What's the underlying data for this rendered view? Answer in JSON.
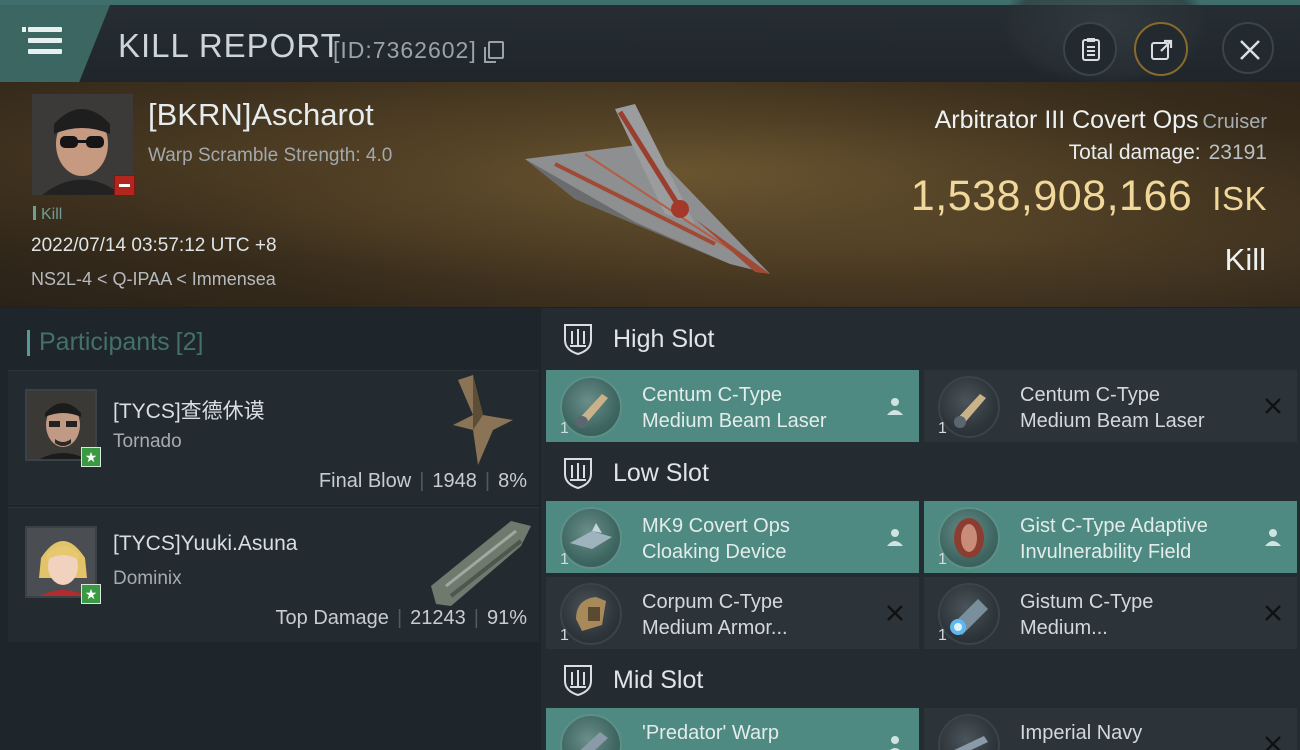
{
  "header": {
    "title": "KILL REPORT",
    "kill_id": "[ID:7362602]"
  },
  "victim": {
    "name": "[BKRN]Ascharot",
    "warp_scramble": "Warp Scramble Strength: 4.0",
    "tag": "Kill",
    "datetime": "2022/07/14 03:57:12 UTC +8",
    "location": "NS2L-4 < Q-IPAA < Immensea",
    "ship_name": "Arbitrator III Covert Ops",
    "ship_class": "Cruiser",
    "total_damage_label": "Total damage:",
    "total_damage_value": "23191",
    "isk_value": "1,538,908,166",
    "isk_unit": "ISK",
    "result": "Kill"
  },
  "participants": {
    "label": "Participants",
    "count": "[2]",
    "items": [
      {
        "name": "[TYCS]查德休谟",
        "ship": "Tornado",
        "role": "Final Blow",
        "damage": "1948",
        "percent": "8%"
      },
      {
        "name": "[TYCS]Yuuki.Asuna",
        "ship": "Dominix",
        "role": "Top Damage",
        "damage": "21243",
        "percent": "91%"
      }
    ]
  },
  "slots": {
    "high": {
      "title": "High Slot",
      "modules": [
        {
          "name": "Centum C-Type\nMedium Beam Laser",
          "qty": "1",
          "state": "dropped"
        },
        {
          "name": "Centum C-Type\nMedium Beam Laser",
          "qty": "1",
          "state": "destroyed"
        }
      ]
    },
    "low": {
      "title": "Low Slot",
      "modules": [
        {
          "name": "MK9 Covert Ops\nCloaking Device",
          "qty": "1",
          "state": "dropped"
        },
        {
          "name": "Gist C-Type Adaptive\nInvulnerability Field",
          "qty": "1",
          "state": "dropped"
        },
        {
          "name": "Corpum C-Type\nMedium Armor...",
          "qty": "1",
          "state": "destroyed"
        },
        {
          "name": "Gistum C-Type\nMedium...",
          "qty": "1",
          "state": "destroyed"
        }
      ]
    },
    "mid": {
      "title": "Mid Slot",
      "modules": [
        {
          "name": "'Predator' Warp",
          "qty": "1",
          "state": "dropped"
        },
        {
          "name": "Imperial Navy",
          "qty": "1",
          "state": "destroyed"
        }
      ]
    }
  },
  "colors": {
    "accent_teal": "#4f8a82",
    "isk_gold": "#f0d79a",
    "badge_red": "#b3261e",
    "badge_green": "#3a9a43"
  },
  "icons": [
    "menu-icon",
    "copy-icon",
    "report-icon",
    "share-icon",
    "close-icon",
    "shield-slot-icon",
    "person-icon",
    "x-icon",
    "star-icon"
  ]
}
